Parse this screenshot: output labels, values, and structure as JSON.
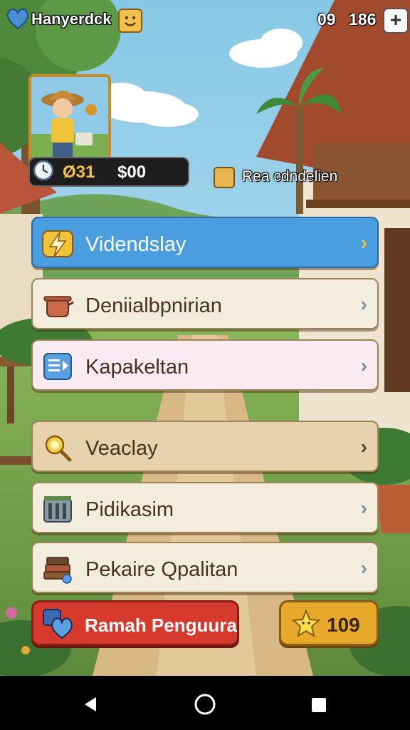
{
  "hud": {
    "player_name": "Hanyerdck",
    "stat_left": "09",
    "stat_right": "186",
    "plus_label": "+"
  },
  "profile": {
    "resource_a": "Ø31",
    "resource_b": "$00"
  },
  "badge": {
    "text": "Rea cdndelien"
  },
  "menu": [
    {
      "label": "Videndslay",
      "icon": "lightning-icon",
      "bg": "#4a9ee0"
    },
    {
      "label": "Deniialbpnirian",
      "icon": "cooking-pot-icon",
      "bg": "#f3eddd"
    },
    {
      "label": "Kapakeltan",
      "icon": "document-icon",
      "bg": "#faeaf1"
    },
    {
      "label": "Veaclay",
      "icon": "magnifier-icon",
      "bg": "#e6d3ae"
    },
    {
      "label": "Pidikasim",
      "icon": "crate-icon",
      "bg": "#f3eddd"
    },
    {
      "label": "Pekaire Qpalitan",
      "icon": "books-icon",
      "bg": "#f3eddd"
    }
  ],
  "bottom": {
    "red_label": "Ramah Penguura",
    "gold_value": "109"
  },
  "colors": {
    "accent_blue": "#4a9ee0",
    "red_button": "#d63a2c",
    "gold_button": "#e7a92a"
  }
}
